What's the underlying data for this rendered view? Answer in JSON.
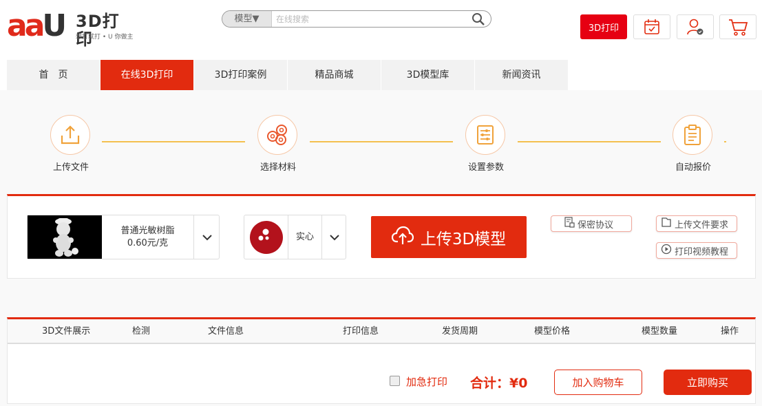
{
  "header": {
    "logo_title": "3D打印",
    "logo_subtitle": "想打就打 • U 你做主",
    "search": {
      "type_label": "模型▼",
      "placeholder": "在线搜索"
    },
    "print_button": "3D打印"
  },
  "nav": {
    "items": [
      {
        "label": "首　页",
        "active": false
      },
      {
        "label": "在线3D打印",
        "active": true
      },
      {
        "label": "3D打印案例",
        "active": false
      },
      {
        "label": "精品商城",
        "active": false
      },
      {
        "label": "3D模型库",
        "active": false
      },
      {
        "label": "新闻资讯",
        "active": false
      }
    ]
  },
  "steps": [
    {
      "label": "上传文件",
      "icon": "upload-icon"
    },
    {
      "label": "选择材料",
      "icon": "material-rolls-icon"
    },
    {
      "label": "设置参数",
      "icon": "sliders-icon"
    },
    {
      "label": "自动报价",
      "icon": "clipboard-icon"
    }
  ],
  "upload": {
    "material_name": "普通光敏树脂",
    "material_price": "0.60元/克",
    "fill_label": "实心",
    "upload_button": "上传3D模型",
    "privacy": "保密协议",
    "file_requirements": "上传文件要求",
    "video_tutorial": "打印视频教程"
  },
  "table": {
    "headers": [
      "3D文件展示",
      "检测",
      "文件信息",
      "打印信息",
      "发货周期",
      "模型价格",
      "模型数量",
      "操作"
    ],
    "urgent_label": "加急打印",
    "total_label": "合计：¥0",
    "add_cart_button": "加入购物车",
    "buy_button": "立即购买"
  },
  "colors": {
    "accent": "#e22b0f",
    "step_line": "#f4c04f",
    "step_icon": "#f0a23a"
  }
}
